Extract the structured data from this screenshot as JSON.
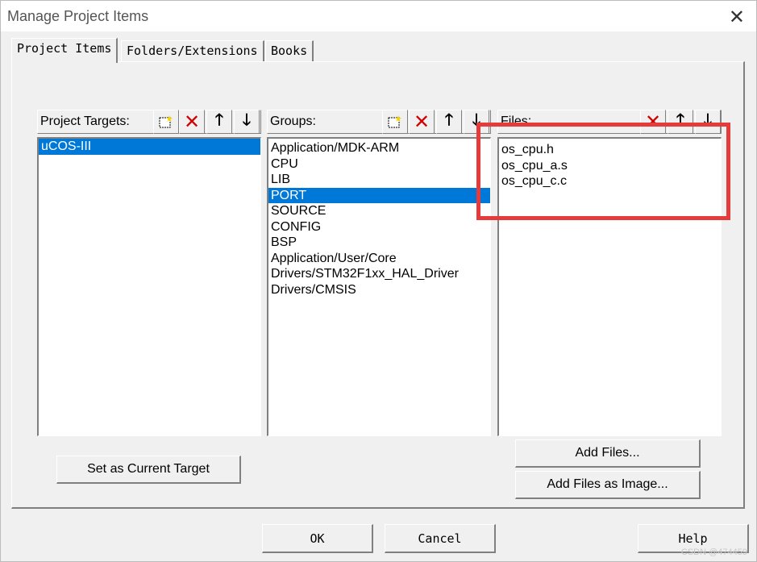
{
  "window": {
    "title": "Manage Project Items",
    "close_glyph": "✕"
  },
  "tabs": [
    {
      "label": "Project Items"
    },
    {
      "label": "Folders/Extensions"
    },
    {
      "label": "Books"
    }
  ],
  "targets": {
    "label": "Project Targets:",
    "items": [
      {
        "label": "uCOS-III",
        "selected": true
      }
    ]
  },
  "groups": {
    "label": "Groups:",
    "items": [
      {
        "label": "Application/MDK-ARM"
      },
      {
        "label": "CPU"
      },
      {
        "label": "LIB"
      },
      {
        "label": "PORT",
        "selected": true
      },
      {
        "label": "SOURCE"
      },
      {
        "label": "CONFIG"
      },
      {
        "label": "BSP"
      },
      {
        "label": "Application/User/Core"
      },
      {
        "label": "Drivers/STM32F1xx_HAL_Driver"
      },
      {
        "label": "Drivers/CMSIS"
      }
    ]
  },
  "files": {
    "label": "Files:",
    "items": [
      {
        "label": "os_cpu.h"
      },
      {
        "label": "os_cpu_a.s"
      },
      {
        "label": "os_cpu_c.c"
      }
    ]
  },
  "buttons": {
    "set_target": "Set as Current Target",
    "add_files": "Add Files...",
    "add_files_image": "Add Files as Image...",
    "ok": "OK",
    "cancel": "Cancel",
    "help": "Help"
  },
  "icons": {
    "new": "new-item-icon",
    "delete": "delete-icon",
    "up": "move-up-icon",
    "down": "move-down-icon"
  },
  "watermark": "CSDN @474459",
  "colors": {
    "selection": "#0078d7",
    "highlight_box": "#e53b3b",
    "delete": "#d00000"
  }
}
